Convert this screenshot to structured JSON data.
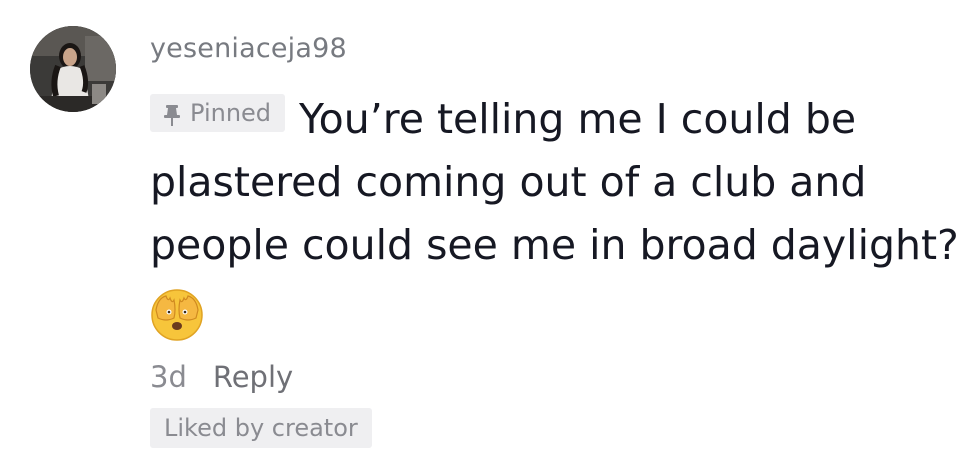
{
  "comment": {
    "username": "yeseniaceja98",
    "pinned_label": "Pinned",
    "text": "You’re telling me I could be plastered coming out of a club and people could see me in broad daylight?",
    "emoji": "face-with-hands-covering-eyes-icon",
    "timestamp": "3d",
    "reply_label": "Reply",
    "liked_by_creator_label": "Liked by creator"
  },
  "colors": {
    "text_primary": "#161823",
    "text_secondary": "#8a8b91",
    "badge_background": "#efeff1"
  }
}
